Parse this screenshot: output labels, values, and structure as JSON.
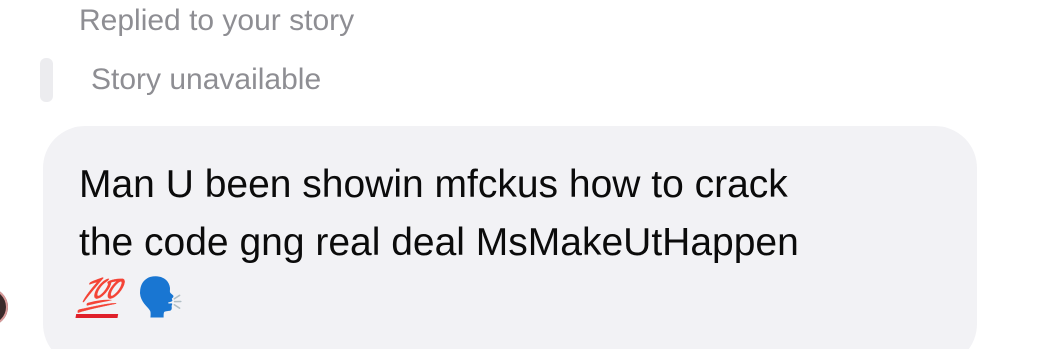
{
  "reply": {
    "header_text": "Replied to your story",
    "story_status": "Story unavailable"
  },
  "message": {
    "text": "Man U been showin mfckus how to crack\nthe code gng real deal MsMakeUtHappen",
    "emojis": [
      "💯",
      "🗣️"
    ]
  },
  "colors": {
    "secondary_text": "#8e8e93",
    "bubble_bg": "#f2f2f5",
    "story_bar": "#ececef"
  }
}
